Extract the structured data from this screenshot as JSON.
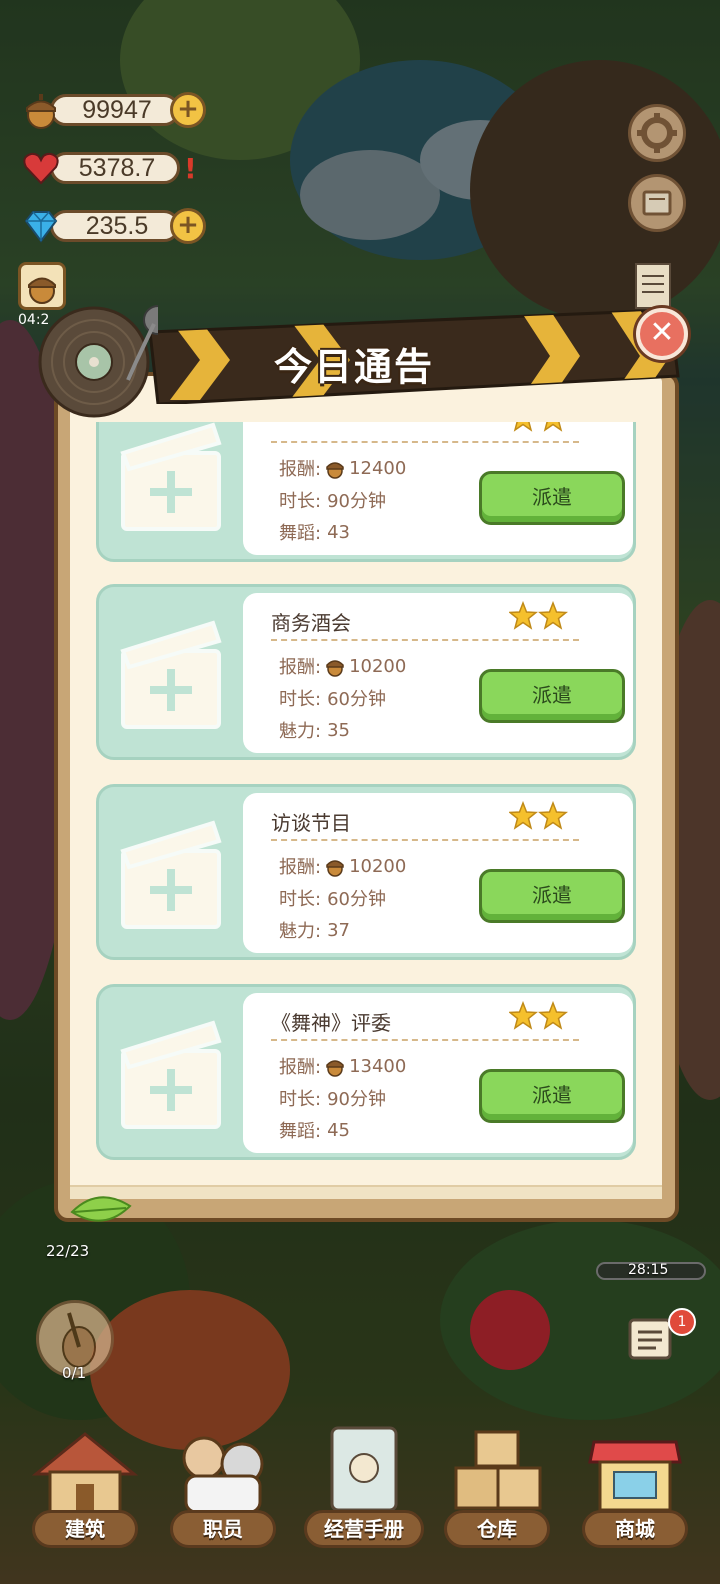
{
  "hud": {
    "acorns": "99947",
    "hearts": "5378.7",
    "gems": "235.5",
    "slot_timer": "04:2",
    "bottom_left_count": "22/23",
    "instrument_count": "0/1",
    "right_timer": "28:15",
    "notice_badge": "1"
  },
  "dialog": {
    "title": "今日通告",
    "close": "✕",
    "labels": {
      "reward": "报酬:",
      "duration": "时长:",
      "dispatch": "派遣"
    },
    "jobs": [
      {
        "title": "",
        "stars": 2,
        "reward": "12400",
        "duration": "90分钟",
        "attr_label": "舞蹈:",
        "attr_value": "43"
      },
      {
        "title": "商务酒会",
        "stars": 2,
        "reward": "10200",
        "duration": "60分钟",
        "attr_label": "魅力:",
        "attr_value": "35"
      },
      {
        "title": "访谈节目",
        "stars": 2,
        "reward": "10200",
        "duration": "60分钟",
        "attr_label": "魅力:",
        "attr_value": "37"
      },
      {
        "title": "《舞神》评委",
        "stars": 2,
        "reward": "13400",
        "duration": "90分钟",
        "attr_label": "舞蹈:",
        "attr_value": "45"
      }
    ]
  },
  "nav": {
    "build": "建筑",
    "staff": "职员",
    "handbook": "经营手册",
    "warehouse": "仓库",
    "shop": "商城"
  },
  "colors": {
    "dispatch_button": "#8ad75b",
    "card_bg": "#bfe3d4",
    "star": "#f5c02c",
    "panel_wood": "#c8a676"
  }
}
